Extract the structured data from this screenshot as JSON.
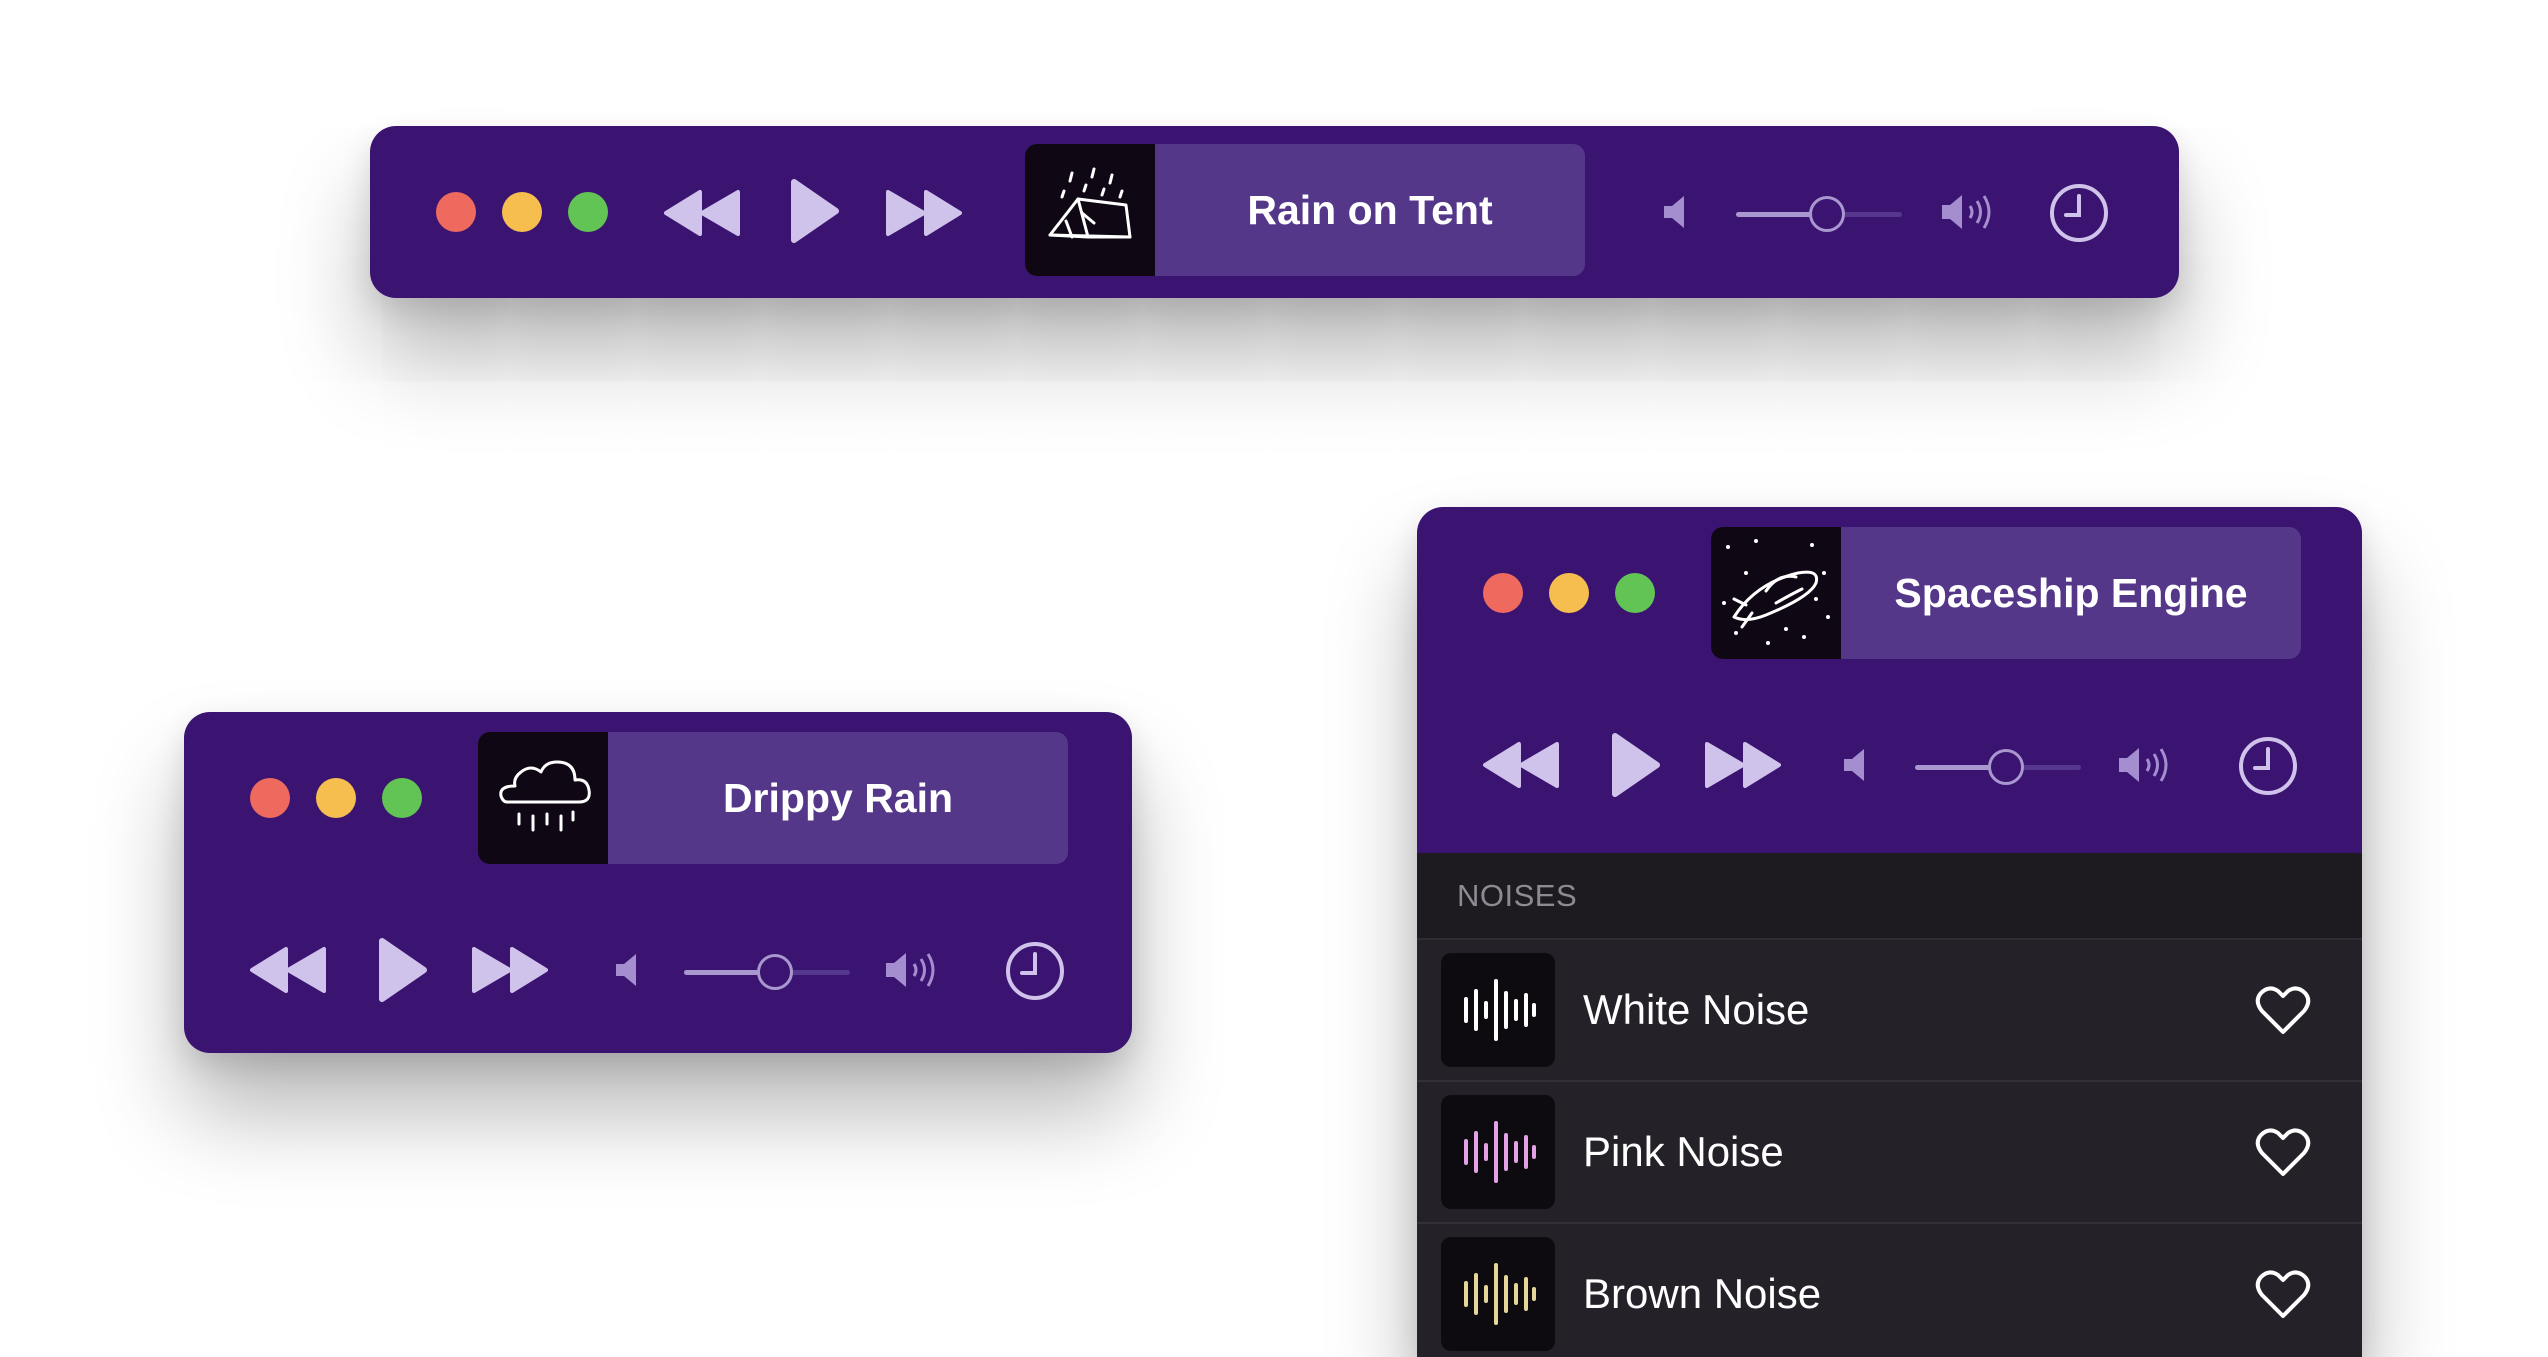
{
  "players": {
    "top": {
      "track_title": "Rain on Tent",
      "artwork": "tent-in-rain-icon",
      "volume": 0.55
    },
    "left": {
      "track_title": "Drippy Rain",
      "artwork": "rain-cloud-icon",
      "volume": 0.55
    },
    "right": {
      "track_title": "Spaceship Engine",
      "artwork": "spaceship-icon",
      "volume": 0.55
    }
  },
  "noise_list": {
    "header": "NOISES",
    "items": [
      {
        "label": "White Noise",
        "wave_color": "#ffffff",
        "icon": "waveform-icon"
      },
      {
        "label": "Pink Noise",
        "wave_color": "#e6a0e6",
        "icon": "waveform-icon"
      },
      {
        "label": "Brown Noise",
        "wave_color": "#e6d69a",
        "icon": "waveform-icon"
      }
    ]
  },
  "colors": {
    "window_bg": "#3a1470",
    "tile_bg": "#55378a",
    "list_bg": "#252128"
  }
}
